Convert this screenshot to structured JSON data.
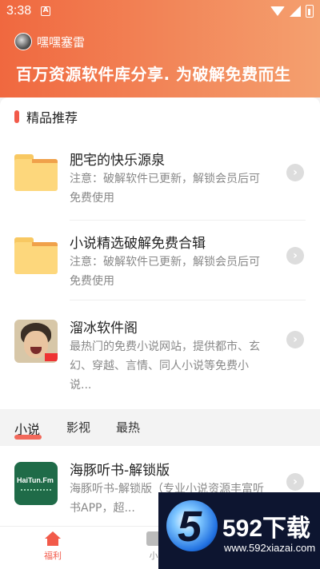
{
  "status_bar": {
    "time": "3:38",
    "notification_glyph": "A"
  },
  "header": {
    "username": "嘿嘿塞雷",
    "slogan": "百万资源软件库分享. 为破解免费而生"
  },
  "featured": {
    "title": "精品推荐",
    "items": [
      {
        "icon": "folder-icon",
        "title": "肥宅的快乐源泉",
        "desc": "注意：破解软件已更新，解锁会员后可免费使用"
      },
      {
        "icon": "folder-icon",
        "title": "小说精选破解免费合辑",
        "desc": "注意：破解软件已更新，解锁会员后可免费使用"
      },
      {
        "icon": "avatar-photo",
        "title": "溜冰软件阁",
        "desc": "最热门的免费小说网站，提供都市、玄幻、穿越、言情、同人小说等免费小说..."
      }
    ]
  },
  "tabs": {
    "items": [
      "小说",
      "影视",
      "最热"
    ],
    "active": "小说"
  },
  "list": {
    "items": [
      {
        "icon_text": "HaiTun.Fm",
        "title": "海豚听书-解锁版",
        "desc": "海豚听书-解锁版（专业小说资源丰富听书APP，超..."
      }
    ]
  },
  "bottom_nav": {
    "items": [
      {
        "label": "福利",
        "active": true
      },
      {
        "label": "小",
        "active": false
      }
    ]
  },
  "watermark": {
    "logo_digit": "5",
    "brand": "592下载",
    "url": "www.592xiazai.com"
  },
  "colors": {
    "accent": "#f25a4a",
    "header_start": "#f0683f",
    "header_end": "#f4a06f"
  }
}
